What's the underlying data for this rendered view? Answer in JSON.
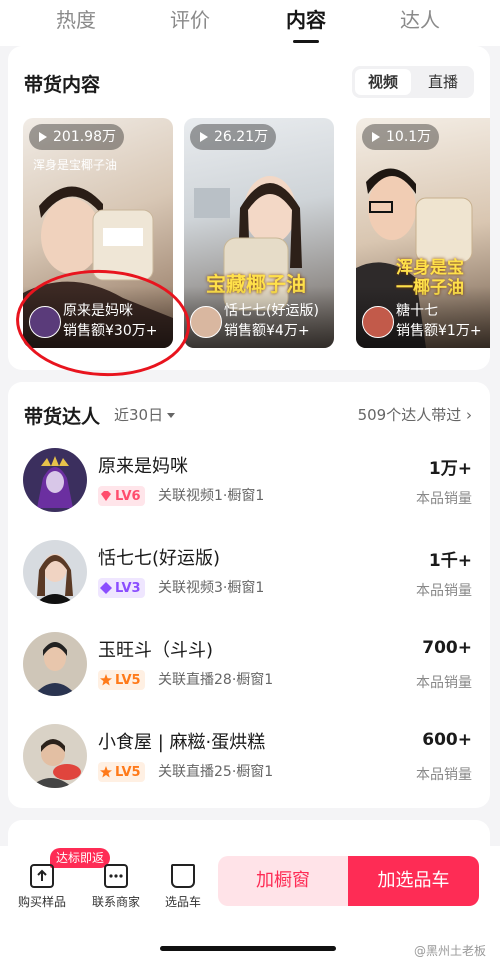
{
  "tabs": [
    "热度",
    "评价",
    "内容",
    "达人"
  ],
  "content_section": {
    "title": "带货内容",
    "segment": [
      "视频",
      "直播"
    ],
    "videos": [
      {
        "views": "201.98万",
        "caption": "浑身是宝椰子油",
        "name": "原来是妈咪",
        "sales": "销售额¥30万+"
      },
      {
        "views": "26.21万",
        "banner": "宝藏椰子油",
        "name": "恬七七(好运版)",
        "sales": "销售额¥4万+"
      },
      {
        "views": "10.1万",
        "banner": "浑身是宝\n一椰子油",
        "name": "糖十七",
        "sales": "销售额¥1万+"
      }
    ]
  },
  "creators_section": {
    "title": "带货达人",
    "range": "近30日",
    "more": "509个达人带过",
    "count_label": "本品销量",
    "rows": [
      {
        "name": "原来是妈咪",
        "level": "LV6",
        "meta": "关联视频1·橱窗1",
        "count": "1万+",
        "lv_color": "#ff4d6d",
        "lv_bg": "#ffe5ea"
      },
      {
        "name": "恬七七(好运版)",
        "level": "LV3",
        "meta": "关联视频3·橱窗1",
        "count": "1千+",
        "lv_color": "#8b4dff",
        "lv_bg": "#efe6ff"
      },
      {
        "name": "玉旺斗（斗斗)",
        "level": "LV5",
        "meta": "关联直播28·橱窗1",
        "count": "700+",
        "lv_color": "#ff7a1a",
        "lv_bg": "#fff0e3"
      },
      {
        "name": "小食屋 | 麻糍·蛋烘糕",
        "level": "LV5",
        "meta": "关联直播25·橱窗1",
        "count": "600+",
        "lv_color": "#ff7a1a",
        "lv_bg": "#fff0e3"
      }
    ]
  },
  "bottom_bar": {
    "badge": "达标即返",
    "buy_sample": "购买样品",
    "contact": "联系商家",
    "cart": "选品车",
    "add_window": "加橱窗",
    "add_select": "加选品车"
  },
  "watermark": "@黑州土老板",
  "colors": {
    "accent": "#fe2c55"
  }
}
